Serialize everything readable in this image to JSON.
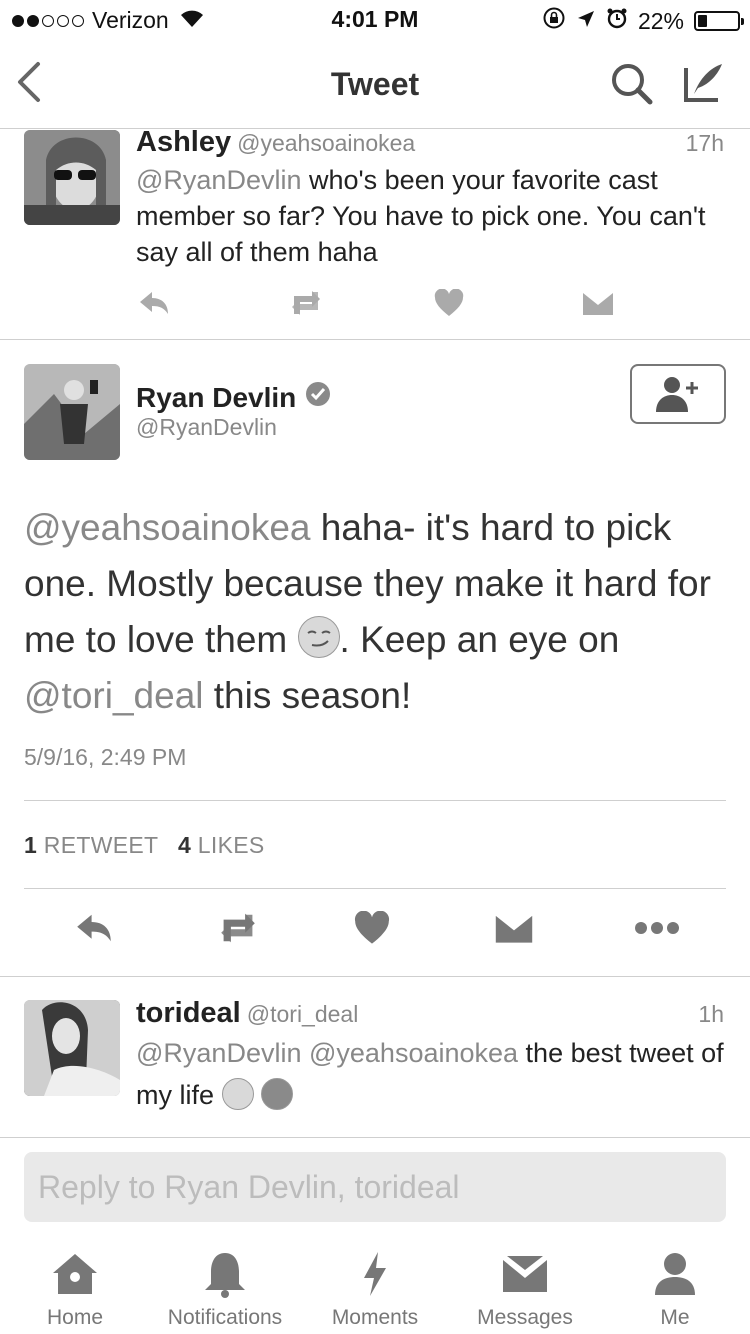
{
  "status_bar": {
    "carrier": "Verizon",
    "time": "4:01 PM",
    "battery": "22%",
    "battery_level": 0.22
  },
  "nav": {
    "title": "Tweet"
  },
  "reply_tweet": {
    "name": "Ashley",
    "handle": "@yeahsoainokea",
    "time": "17h",
    "mention": "@RyanDevlin",
    "text": " who's been your favorite cast member so far? You have to pick one. You can't say all of them haha"
  },
  "main_tweet": {
    "name": "Ryan Devlin",
    "handle": "@RyanDevlin",
    "mention1": "@yeahsoainokea",
    "text1": " haha- it's hard to pick one. Mostly because they make it hard for me to love them ",
    "text2": ". Keep an eye on ",
    "mention2": "@tori_deal",
    "text3": " this season!",
    "date": "5/9/16, 2:49 PM",
    "retweet_count": "1",
    "retweet_label": "RETWEET",
    "like_count": "4",
    "like_label": "LIKES"
  },
  "second_reply": {
    "name": "torideal",
    "handle": "@tori_deal",
    "time": "1h",
    "mention1": "@RyanDevlin",
    "mention2": "@yeahsoainokea",
    "text": " the best tweet of my life "
  },
  "reply_box": {
    "placeholder": "Reply to Ryan Devlin, torideal"
  },
  "tabs": [
    {
      "label": "Home",
      "icon": "home-icon"
    },
    {
      "label": "Notifications",
      "icon": "bell-icon"
    },
    {
      "label": "Moments",
      "icon": "lightning-icon"
    },
    {
      "label": "Messages",
      "icon": "envelope-icon"
    },
    {
      "label": "Me",
      "icon": "person-icon"
    }
  ]
}
